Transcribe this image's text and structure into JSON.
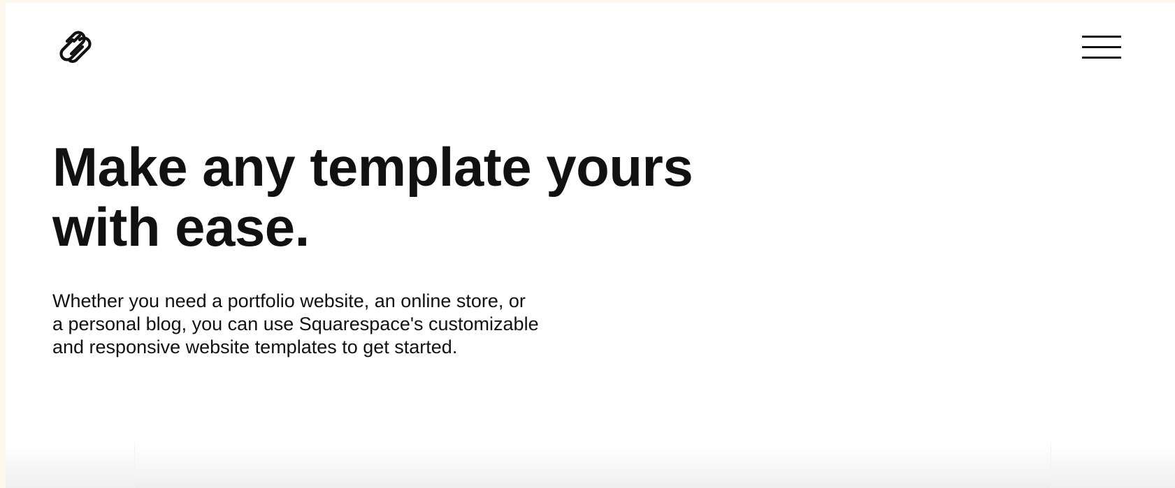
{
  "header": {
    "logo_icon": "squarespace-logo-icon",
    "menu_icon": "hamburger-menu-icon"
  },
  "hero": {
    "title_lines": [
      "Make any template yours",
      "with ease."
    ],
    "description_lines": [
      "Whether you need a portfolio website, an online store, or",
      "a personal blog, you can use Squarespace's customizable",
      "and responsive website templates to get started."
    ]
  },
  "colors": {
    "text": "#111111",
    "background": "#ffffff",
    "frame": "#fdf7ee"
  }
}
